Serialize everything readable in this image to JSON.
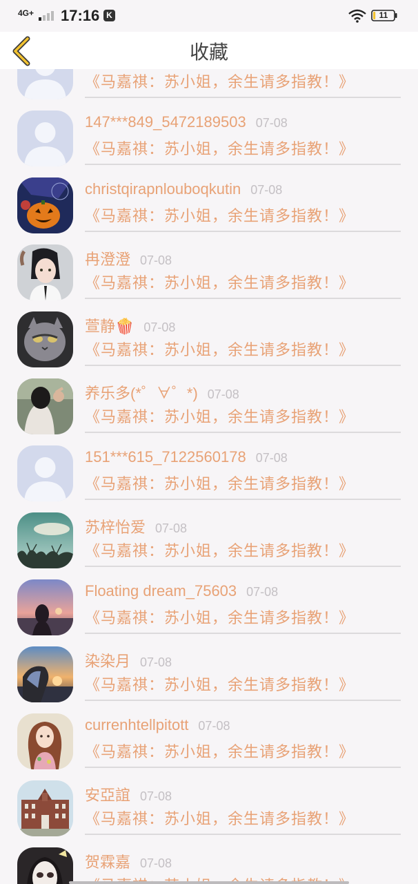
{
  "status_bar": {
    "network": "4G+",
    "time": "17:16",
    "k_badge": "K",
    "battery": "11",
    "battery_level": 0.11
  },
  "header": {
    "title": "收藏",
    "back_icon": "chevron-left-icon",
    "accent_color": "#f2c230"
  },
  "list": {
    "items": [
      {
        "name": "",
        "date": "",
        "title": "《马嘉祺：苏小姐，余生请多指教！》",
        "avatar": "default"
      },
      {
        "name": "147***849_5472189503",
        "date": "07-08",
        "title": "《马嘉祺：苏小姐，余生请多指教！》",
        "avatar": "default"
      },
      {
        "name": "christqirapnlouboqkutin",
        "date": "07-08",
        "title": "《马嘉祺：苏小姐，余生请多指教！》",
        "avatar": "pumpkin"
      },
      {
        "name": "冉澄澄",
        "date": "07-08",
        "title": "《马嘉祺：苏小姐，余生请多指教！》",
        "avatar": "anime-girl"
      },
      {
        "name": "萱静🍿",
        "date": "07-08",
        "title": "《马嘉祺：苏小姐，余生请多指教！》",
        "avatar": "cat"
      },
      {
        "name": "养乐多(*゜∀゜*)",
        "date": "07-08",
        "title": "《马嘉祺：苏小姐，余生请多指教！》",
        "avatar": "girl-photo"
      },
      {
        "name": "151***615_7122560178",
        "date": "07-08",
        "title": "《马嘉祺：苏小姐，余生请多指教！》",
        "avatar": "default"
      },
      {
        "name": "苏梓怡爱",
        "date": "07-08",
        "title": "《马嘉祺：苏小姐，余生请多指教！》",
        "avatar": "trees-sky"
      },
      {
        "name": "Floating dream_75603",
        "date": "07-08",
        "title": "《马嘉祺：苏小姐，余生请多指教！》",
        "avatar": "sunset-girl"
      },
      {
        "name": "染染月",
        "date": "07-08",
        "title": "《马嘉祺：苏小姐，余生请多指教！》",
        "avatar": "sunset-silhouette"
      },
      {
        "name": "currenhtellpitott",
        "date": "07-08",
        "title": "《马嘉祺：苏小姐，余生请多指教！》",
        "avatar": "girl-portrait"
      },
      {
        "name": "安亞誼",
        "date": "07-08",
        "title": "《马嘉祺：苏小姐，余生请多指教！》",
        "avatar": "building"
      },
      {
        "name": "贺霖嘉",
        "date": "07-08",
        "title": "《马嘉祺：苏小姐，余生请多指教！》",
        "avatar": "face-mask"
      }
    ]
  },
  "colors": {
    "name_text": "#e8a276",
    "date_text": "#c4c0c4",
    "background": "#f7f5f7"
  }
}
